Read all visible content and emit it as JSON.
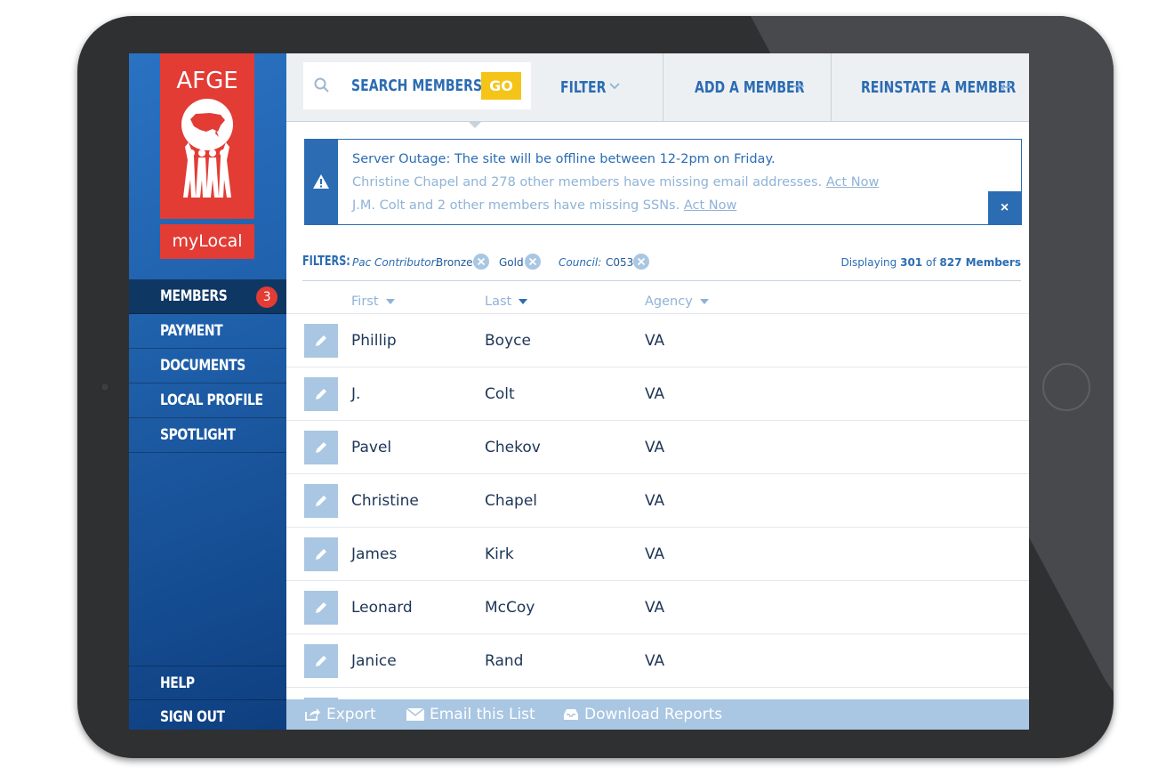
{
  "sidebar": {
    "logo_text": "AFGE",
    "sublogo_text": "myLocal",
    "nav": [
      {
        "label": "MEMBERS",
        "badge": "3"
      },
      {
        "label": "PAYMENT"
      },
      {
        "label": "DOCUMENTS"
      },
      {
        "label": "LOCAL PROFILE"
      },
      {
        "label": "SPOTLIGHT"
      }
    ],
    "bottom_nav": [
      {
        "label": "HELP"
      },
      {
        "label": "SIGN OUT"
      }
    ]
  },
  "topbar": {
    "search_label": "SEARCH MEMBERS",
    "go_label": "GO",
    "filter_label": "FILTER",
    "add_member_label": "ADD A MEMBER",
    "reinstate_label": "REINSTATE A MEMBER"
  },
  "alert": {
    "line1": "Server Outage: The site will be offline between 12-2pm on Friday.",
    "line2_text": "Christine Chapel and 278 other members have missing email addresses.",
    "line2_link": "Act Now",
    "line3_text": "J.M. Colt and 2 other members have missing SSNs.",
    "line3_link": "Act Now",
    "close_label": "×"
  },
  "filters": {
    "label": "FILTERS:",
    "groups": [
      {
        "key": "Pac Contributor:",
        "values": [
          "Bronze",
          "Gold"
        ]
      },
      {
        "key": "Council:",
        "values": [
          "C053"
        ]
      }
    ],
    "displaying_prefix": "Displaying",
    "displaying_count": "301",
    "displaying_of": "of",
    "displaying_total": "827 Members"
  },
  "table": {
    "columns": [
      "First",
      "Last",
      "Agency"
    ],
    "rows": [
      {
        "first": "Phillip",
        "last": "Boyce",
        "agency": "VA"
      },
      {
        "first": "J.",
        "last": "Colt",
        "agency": "VA"
      },
      {
        "first": "Pavel",
        "last": "Chekov",
        "agency": "VA"
      },
      {
        "first": "Christine",
        "last": "Chapel",
        "agency": "VA"
      },
      {
        "first": "James",
        "last": "Kirk",
        "agency": "VA"
      },
      {
        "first": "Leonard",
        "last": "McCoy",
        "agency": "VA"
      },
      {
        "first": "Janice",
        "last": "Rand",
        "agency": "VA"
      }
    ]
  },
  "footer": {
    "export_label": "Export",
    "email_label": "Email this List",
    "download_label": "Download Reports"
  },
  "colors": {
    "brand_red": "#e23c35",
    "brand_blue": "#2b6cb3",
    "go_yellow": "#f4c419",
    "sidebar_active": "#0f3763"
  }
}
